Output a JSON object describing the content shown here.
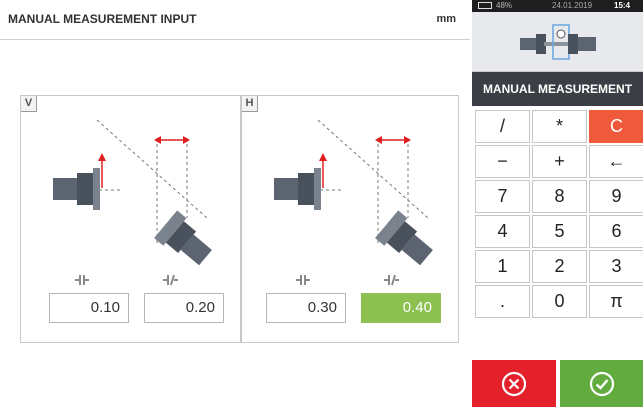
{
  "header": {
    "title": "MANUAL MEASUREMENT INPUT",
    "unit": "mm"
  },
  "panels": [
    {
      "badge": "V",
      "values": [
        "0.10",
        "0.20"
      ]
    },
    {
      "badge": "H",
      "values": [
        "0.30",
        "0.40"
      ]
    }
  ],
  "status": {
    "battery": "48%",
    "date": "24.01.2019",
    "time": "15:4"
  },
  "mode_bar": {
    "label": "MANUAL MEASUREMENT"
  },
  "keypad": {
    "keys": [
      "/",
      "*",
      "C",
      "−",
      "+",
      "←",
      "7",
      "8",
      "9",
      "4",
      "5",
      "6",
      "1",
      "2",
      "3",
      ".",
      "0",
      "π"
    ]
  },
  "actions": {
    "cancel_icon": "cancel-x-icon",
    "confirm_icon": "confirm-check-icon"
  },
  "colors": {
    "accent_green": "#8cc152",
    "confirm_green": "#62ab3f",
    "cancel_red": "#e4202b",
    "clear_key": "#f05a3c",
    "indicator_red": "#e02020"
  }
}
